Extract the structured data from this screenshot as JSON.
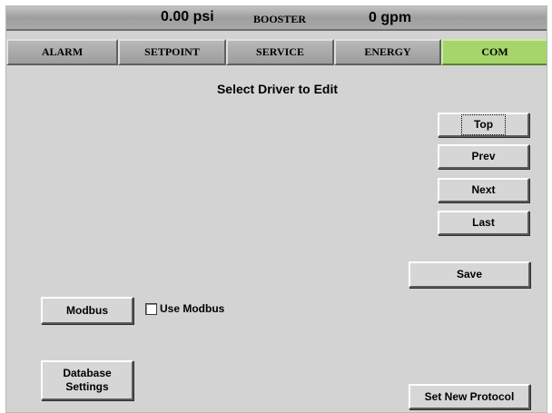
{
  "status": {
    "pressure": "0.00 psi",
    "mode": "BOOSTER",
    "flow": "0 gpm"
  },
  "tabs": [
    {
      "label": "ALARM"
    },
    {
      "label": "SETPOINT"
    },
    {
      "label": "SERVICE"
    },
    {
      "label": "ENERGY"
    },
    {
      "label": "COM"
    }
  ],
  "active_tab": "COM",
  "colors": {
    "active_tab": "#a6d56b",
    "panel_background": "#d3d3d3"
  },
  "page": {
    "title": "Select Driver to Edit"
  },
  "nav": {
    "top": "Top",
    "prev": "Prev",
    "next": "Next",
    "last": "Last"
  },
  "actions": {
    "save": "Save",
    "modbus": "Modbus",
    "use_modbus_label": "Use Modbus",
    "use_modbus_checked": false,
    "database_settings_line1": "Database",
    "database_settings_line2": "Settings",
    "set_new_protocol": "Set New Protocol"
  }
}
